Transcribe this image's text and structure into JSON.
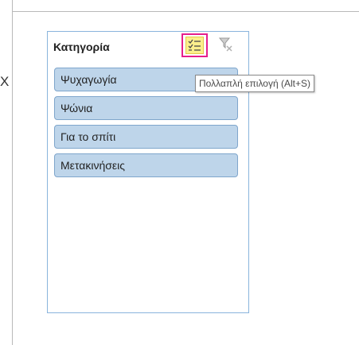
{
  "row_marker": "X",
  "slicer": {
    "title": "Κατηγορία",
    "multi_select_icon": "multi-select-icon",
    "clear_filter_icon": "clear-filter-icon",
    "items": [
      {
        "label": "Ψυχαγωγία"
      },
      {
        "label": "Ψώνια"
      },
      {
        "label": "Για το σπίτι"
      },
      {
        "label": "Μετακινήσεις"
      }
    ]
  },
  "tooltip": {
    "text": "Πολλαπλή επιλογή (Alt+S)"
  },
  "colors": {
    "highlight": "#e61e8c",
    "selected_item": "#bed5ea",
    "slicer_border": "#89b4dc",
    "icon_fill": "#fbef8c"
  }
}
